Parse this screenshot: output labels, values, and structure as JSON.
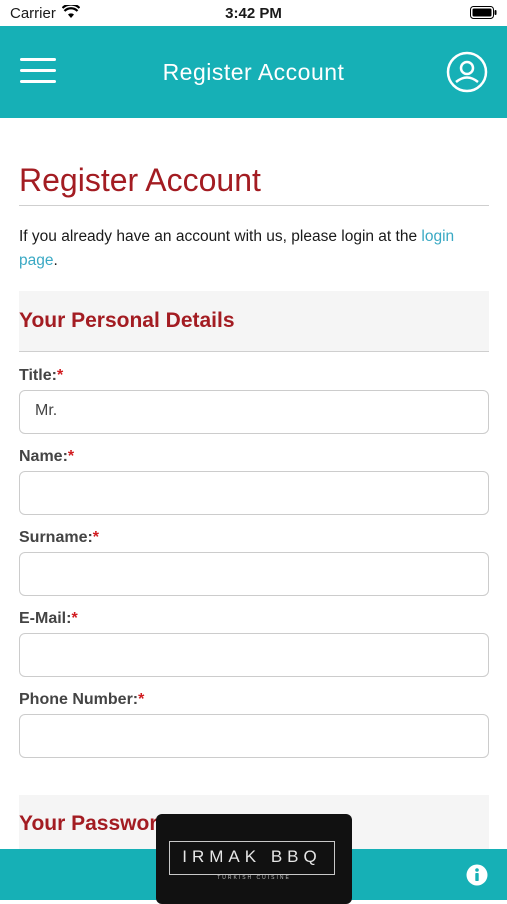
{
  "status_bar": {
    "carrier": "Carrier",
    "time": "3:42 PM"
  },
  "header": {
    "title": "Register Account"
  },
  "main": {
    "page_title": "Register Account",
    "intro_text": "If you already have an account with us, please login at the ",
    "intro_link": "login page",
    "intro_end": ".",
    "personal_section": "Your Personal Details",
    "fields": [
      {
        "label": "Title:",
        "value": "Mr."
      },
      {
        "label": "Name:",
        "value": ""
      },
      {
        "label": "Surname:",
        "value": ""
      },
      {
        "label": "E-Mail:",
        "value": ""
      },
      {
        "label": "Phone Number:",
        "value": ""
      }
    ],
    "required_marker": "*",
    "password_section": "Your Password"
  },
  "logo": {
    "name": "IRMAK BBQ",
    "tagline": "TURKISH CUISINE"
  },
  "colors": {
    "brand": "#16b0b6",
    "heading": "#a31c22",
    "link": "#3aa9c4",
    "required": "#d11c20"
  }
}
